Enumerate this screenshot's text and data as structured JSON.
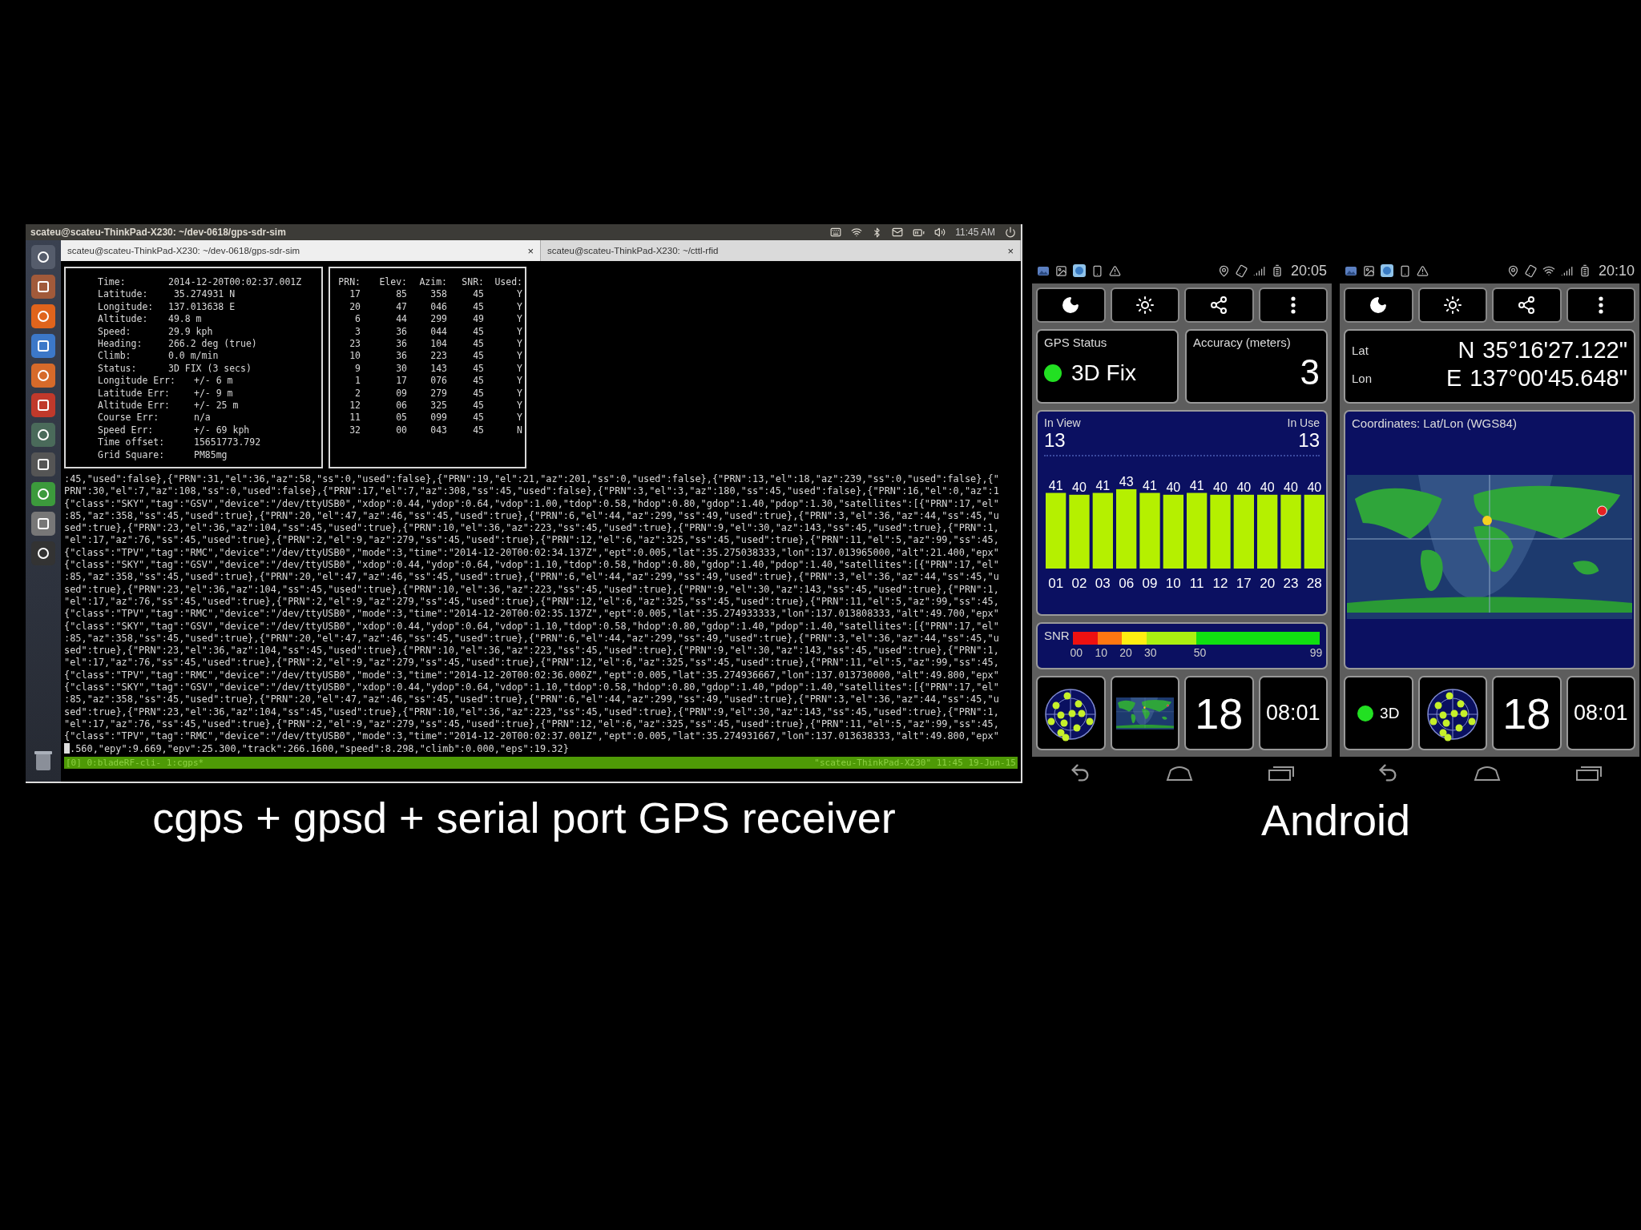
{
  "terminal": {
    "top_panel": {
      "title": "scateu@scateu-ThinkPad-X230: ~/dev-0618/gps-sdr-sim",
      "clock": "11:45 AM"
    },
    "tabs": [
      {
        "label": "scateu@scateu-ThinkPad-X230: ~/dev-0618/gps-sdr-sim",
        "close": "×",
        "selected": true
      },
      {
        "label": "scateu@scateu-ThinkPad-X230: ~/cttl-rfid",
        "close": "×",
        "selected": false
      }
    ],
    "cgps": {
      "fix_fields": [
        {
          "label": "Time:",
          "value": "2014-12-20T00:02:37.001Z"
        },
        {
          "label": "Latitude:",
          "value": " 35.274931 N"
        },
        {
          "label": "Longitude:",
          "value": "137.013638 E"
        },
        {
          "label": "Altitude:",
          "value": "49.8 m"
        },
        {
          "label": "Speed:",
          "value": "29.9 kph"
        },
        {
          "label": "Heading:",
          "value": "266.2 deg (true)"
        },
        {
          "label": "Climb:",
          "value": "0.0 m/min"
        },
        {
          "label": "Status:",
          "value": "3D FIX (3 secs)"
        }
      ],
      "error_fields": [
        {
          "label": "Longitude Err:",
          "value": "+/- 6 m"
        },
        {
          "label": "Latitude Err:",
          "value": "+/- 9 m"
        },
        {
          "label": "Altitude Err:",
          "value": "+/- 25 m"
        },
        {
          "label": "Course Err:",
          "value": "n/a"
        },
        {
          "label": "Speed Err:",
          "value": "+/- 69 kph"
        },
        {
          "label": "Time offset:",
          "value": "15651773.792"
        },
        {
          "label": "Grid Square:",
          "value": "PM85mg"
        }
      ],
      "satellites": {
        "columns": [
          "PRN:",
          "Elev:",
          "Azim:",
          "SNR:",
          "Used:"
        ],
        "rows": [
          [
            "17",
            "85",
            "358",
            "45",
            "Y"
          ],
          [
            "20",
            "47",
            "046",
            "45",
            "Y"
          ],
          [
            "6",
            "44",
            "299",
            "49",
            "Y"
          ],
          [
            "3",
            "36",
            "044",
            "45",
            "Y"
          ],
          [
            "23",
            "36",
            "104",
            "45",
            "Y"
          ],
          [
            "10",
            "36",
            "223",
            "45",
            "Y"
          ],
          [
            "9",
            "30",
            "143",
            "45",
            "Y"
          ],
          [
            "1",
            "17",
            "076",
            "45",
            "Y"
          ],
          [
            "2",
            "09",
            "279",
            "45",
            "Y"
          ],
          [
            "12",
            "06",
            "325",
            "45",
            "Y"
          ],
          [
            "11",
            "05",
            "099",
            "45",
            "Y"
          ],
          [
            "32",
            "00",
            "043",
            "45",
            "N"
          ]
        ]
      }
    },
    "log_lines": [
      ":45,\"used\":false},{\"PRN\":31,\"el\":36,\"az\":58,\"ss\":0,\"used\":false},{\"PRN\":19,\"el\":21,\"az\":201,\"ss\":0,\"used\":false},{\"PRN\":13,\"el\":18,\"az\":239,\"ss\":0,\"used\":false},{\"",
      "PRN\":30,\"el\":7,\"az\":108,\"ss\":0,\"used\":false},{\"PRN\":17,\"el\":7,\"az\":308,\"ss\":45,\"used\":false},{\"PRN\":3,\"el\":3,\"az\":180,\"ss\":45,\"used\":false},{\"PRN\":16,\"el\":0,\"az\":1",
      "{\"class\":\"SKY\",\"tag\":\"GSV\",\"device\":\"/dev/ttyUSB0\",\"xdop\":0.44,\"ydop\":0.64,\"vdop\":1.00,\"tdop\":0.58,\"hdop\":0.80,\"gdop\":1.40,\"pdop\":1.30,\"satellites\":[{\"PRN\":17,\"el\"",
      ":85,\"az\":358,\"ss\":45,\"used\":true},{\"PRN\":20,\"el\":47,\"az\":46,\"ss\":45,\"used\":true},{\"PRN\":6,\"el\":44,\"az\":299,\"ss\":49,\"used\":true},{\"PRN\":3,\"el\":36,\"az\":44,\"ss\":45,\"u",
      "sed\":true},{\"PRN\":23,\"el\":36,\"az\":104,\"ss\":45,\"used\":true},{\"PRN\":10,\"el\":36,\"az\":223,\"ss\":45,\"used\":true},{\"PRN\":9,\"el\":30,\"az\":143,\"ss\":45,\"used\":true},{\"PRN\":1,",
      "\"el\":17,\"az\":76,\"ss\":45,\"used\":true},{\"PRN\":2,\"el\":9,\"az\":279,\"ss\":45,\"used\":true},{\"PRN\":12,\"el\":6,\"az\":325,\"ss\":45,\"used\":true},{\"PRN\":11,\"el\":5,\"az\":99,\"ss\":45,",
      "{\"class\":\"TPV\",\"tag\":\"RMC\",\"device\":\"/dev/ttyUSB0\",\"mode\":3,\"time\":\"2014-12-20T00:02:34.137Z\",\"ept\":0.005,\"lat\":35.275038333,\"lon\":137.013965000,\"alt\":21.400,\"epx\"",
      "{\"class\":\"SKY\",\"tag\":\"GSV\",\"device\":\"/dev/ttyUSB0\",\"xdop\":0.44,\"ydop\":0.64,\"vdop\":1.10,\"tdop\":0.58,\"hdop\":0.80,\"gdop\":1.40,\"pdop\":1.40,\"satellites\":[{\"PRN\":17,\"el\"",
      ":85,\"az\":358,\"ss\":45,\"used\":true},{\"PRN\":20,\"el\":47,\"az\":46,\"ss\":45,\"used\":true},{\"PRN\":6,\"el\":44,\"az\":299,\"ss\":49,\"used\":true},{\"PRN\":3,\"el\":36,\"az\":44,\"ss\":45,\"u",
      "sed\":true},{\"PRN\":23,\"el\":36,\"az\":104,\"ss\":45,\"used\":true},{\"PRN\":10,\"el\":36,\"az\":223,\"ss\":45,\"used\":true},{\"PRN\":9,\"el\":30,\"az\":143,\"ss\":45,\"used\":true},{\"PRN\":1,",
      "\"el\":17,\"az\":76,\"ss\":45,\"used\":true},{\"PRN\":2,\"el\":9,\"az\":279,\"ss\":45,\"used\":true},{\"PRN\":12,\"el\":6,\"az\":325,\"ss\":45,\"used\":true},{\"PRN\":11,\"el\":5,\"az\":99,\"ss\":45,",
      "{\"class\":\"TPV\",\"tag\":\"RMC\",\"device\":\"/dev/ttyUSB0\",\"mode\":3,\"time\":\"2014-12-20T00:02:35.137Z\",\"ept\":0.005,\"lat\":35.274933333,\"lon\":137.013808333,\"alt\":49.700,\"epx\"",
      "{\"class\":\"SKY\",\"tag\":\"GSV\",\"device\":\"/dev/ttyUSB0\",\"xdop\":0.44,\"ydop\":0.64,\"vdop\":1.10,\"tdop\":0.58,\"hdop\":0.80,\"gdop\":1.40,\"pdop\":1.40,\"satellites\":[{\"PRN\":17,\"el\"",
      ":85,\"az\":358,\"ss\":45,\"used\":true},{\"PRN\":20,\"el\":47,\"az\":46,\"ss\":45,\"used\":true},{\"PRN\":6,\"el\":44,\"az\":299,\"ss\":49,\"used\":true},{\"PRN\":3,\"el\":36,\"az\":44,\"ss\":45,\"u",
      "sed\":true},{\"PRN\":23,\"el\":36,\"az\":104,\"ss\":45,\"used\":true},{\"PRN\":10,\"el\":36,\"az\":223,\"ss\":45,\"used\":true},{\"PRN\":9,\"el\":30,\"az\":143,\"ss\":45,\"used\":true},{\"PRN\":1,",
      "\"el\":17,\"az\":76,\"ss\":45,\"used\":true},{\"PRN\":2,\"el\":9,\"az\":279,\"ss\":45,\"used\":true},{\"PRN\":12,\"el\":6,\"az\":325,\"ss\":45,\"used\":true},{\"PRN\":11,\"el\":5,\"az\":99,\"ss\":45,",
      "{\"class\":\"TPV\",\"tag\":\"RMC\",\"device\":\"/dev/ttyUSB0\",\"mode\":3,\"time\":\"2014-12-20T00:02:36.000Z\",\"ept\":0.005,\"lat\":35.274936667,\"lon\":137.013730000,\"alt\":49.800,\"epx\"",
      "{\"class\":\"SKY\",\"tag\":\"GSV\",\"device\":\"/dev/ttyUSB0\",\"xdop\":0.44,\"ydop\":0.64,\"vdop\":1.10,\"tdop\":0.58,\"hdop\":0.80,\"gdop\":1.40,\"pdop\":1.40,\"satellites\":[{\"PRN\":17,\"el\"",
      ":85,\"az\":358,\"ss\":45,\"used\":true},{\"PRN\":20,\"el\":47,\"az\":46,\"ss\":45,\"used\":true},{\"PRN\":6,\"el\":44,\"az\":299,\"ss\":49,\"used\":true},{\"PRN\":3,\"el\":36,\"az\":44,\"ss\":45,\"u",
      "sed\":true},{\"PRN\":23,\"el\":36,\"az\":104,\"ss\":45,\"used\":true},{\"PRN\":10,\"el\":36,\"az\":223,\"ss\":45,\"used\":true},{\"PRN\":9,\"el\":30,\"az\":143,\"ss\":45,\"used\":true},{\"PRN\":1,",
      "\"el\":17,\"az\":76,\"ss\":45,\"used\":true},{\"PRN\":2,\"el\":9,\"az\":279,\"ss\":45,\"used\":true},{\"PRN\":12,\"el\":6,\"az\":325,\"ss\":45,\"used\":true},{\"PRN\":11,\"el\":5,\"az\":99,\"ss\":45,",
      "{\"class\":\"TPV\",\"tag\":\"RMC\",\"device\":\"/dev/ttyUSB0\",\"mode\":3,\"time\":\"2014-12-20T00:02:37.001Z\",\"ept\":0.005,\"lat\":35.274931667,\"lon\":137.013638333,\"alt\":49.800,\"epx\"",
      ".560,\"epy\":9.669,\"epv\":25.300,\"track\":266.1600,\"speed\":8.298,\"climb\":0.000,\"eps\":19.32}"
    ],
    "status_bar": {
      "left": "[0] 0:bladeRF-cli- 1:cgps*",
      "right": "\"scateu-ThinkPad-X230\" 11:45 19-Jun-15"
    }
  },
  "caption_left": "cgps + gpsd + serial port GPS receiver",
  "phones": [
    {
      "status_time": "20:05",
      "wifi": false,
      "panels": [
        {
          "kind": "gps_status",
          "label": "GPS Status",
          "fix": "3D Fix"
        },
        {
          "kind": "accuracy",
          "label": "Accuracy (meters)",
          "value": "3"
        },
        {
          "kind": "signal_chart",
          "in_view_label": "In View",
          "in_view": "13",
          "in_use_label": "In Use",
          "in_use": "13",
          "chart_data": {
            "type": "bar",
            "categories": [
              "01",
              "02",
              "03",
              "06",
              "09",
              "10",
              "11",
              "12",
              "17",
              "20",
              "23",
              "28"
            ],
            "values": [
              41,
              40,
              41,
              43,
              41,
              40,
              41,
              40,
              40,
              40,
              40,
              40
            ],
            "data_labels": true
          }
        },
        {
          "kind": "snr_legend",
          "label": "SNR",
          "ticks": [
            "00",
            "10",
            "20",
            "30",
            "50",
            "99"
          ]
        }
      ],
      "tiles": [
        {
          "kind": "sky_plot"
        },
        {
          "kind": "map"
        },
        {
          "kind": "number",
          "text": "18"
        },
        {
          "kind": "number",
          "text": "08:01"
        }
      ]
    },
    {
      "status_time": "20:10",
      "wifi": true,
      "panels": [
        {
          "kind": "coordinates",
          "rows": [
            {
              "label": "Lat",
              "hemisphere": "N",
              "value": "35°16'27.122\""
            },
            {
              "label": "Lon",
              "hemisphere": "E",
              "value": "137°00'45.648\""
            }
          ]
        },
        {
          "kind": "world_map",
          "label": "Coordinates: Lat/Lon (WGS84)"
        }
      ],
      "tiles": [
        {
          "kind": "fix",
          "text": "3D"
        },
        {
          "kind": "sky_plot"
        },
        {
          "kind": "number",
          "text": "18"
        },
        {
          "kind": "number",
          "text": "08:01"
        }
      ]
    }
  ],
  "caption_right": "Android"
}
